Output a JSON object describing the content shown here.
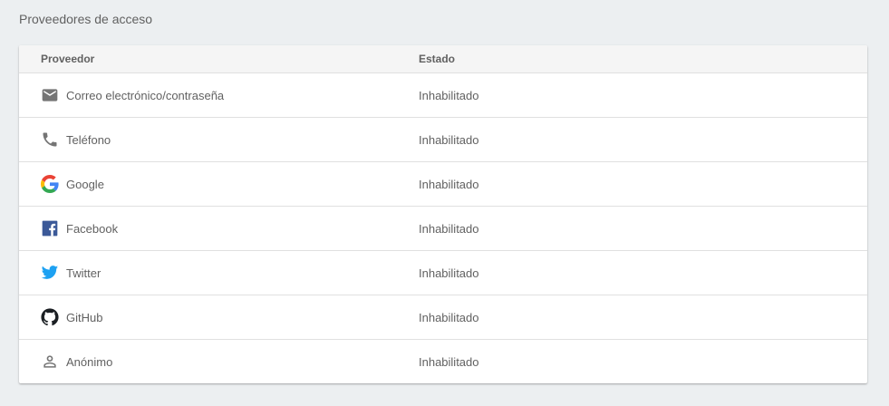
{
  "section": {
    "title": "Proveedores de acceso"
  },
  "table": {
    "headers": {
      "provider": "Proveedor",
      "status": "Estado"
    },
    "rows": [
      {
        "icon": "email-icon",
        "name": "Correo electrónico/contraseña",
        "status": "Inhabilitado"
      },
      {
        "icon": "phone-icon",
        "name": "Teléfono",
        "status": "Inhabilitado"
      },
      {
        "icon": "google-icon",
        "name": "Google",
        "status": "Inhabilitado"
      },
      {
        "icon": "facebook-icon",
        "name": "Facebook",
        "status": "Inhabilitado"
      },
      {
        "icon": "twitter-icon",
        "name": "Twitter",
        "status": "Inhabilitado"
      },
      {
        "icon": "github-icon",
        "name": "GitHub",
        "status": "Inhabilitado"
      },
      {
        "icon": "anonymous-icon",
        "name": "Anónimo",
        "status": "Inhabilitado"
      }
    ]
  },
  "colors": {
    "background": "#eceff1",
    "facebook": "#3b5998",
    "twitter": "#1da1f2",
    "icon_gray": "#757575"
  }
}
